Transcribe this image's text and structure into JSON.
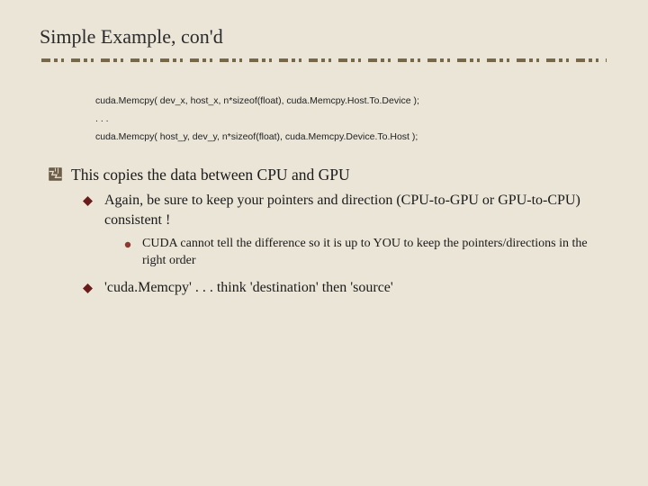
{
  "title": "Simple Example, con'd",
  "code": {
    "line1": "cuda.Memcpy( dev_x, host_x, n*sizeof(float), cuda.Memcpy.Host.To.Device );",
    "line2": ". . .",
    "line3": "cuda.Memcpy( host_y, dev_y, n*sizeof(float), cuda.Memcpy.Device.To.Host );"
  },
  "bullets": {
    "b1": "This copies the data between CPU and GPU",
    "b1_1": "Again, be sure to keep your pointers and direction (CPU-to-GPU or GPU-to-CPU) consistent !",
    "b1_1_1": "CUDA cannot tell the difference so it is up to YOU to keep the pointers/directions in the right order",
    "b1_2": "'cuda.Memcpy' . . . think 'destination' then 'source'"
  },
  "colors": {
    "dark": "#6a1c1c",
    "mid": "#8a3a2f"
  }
}
